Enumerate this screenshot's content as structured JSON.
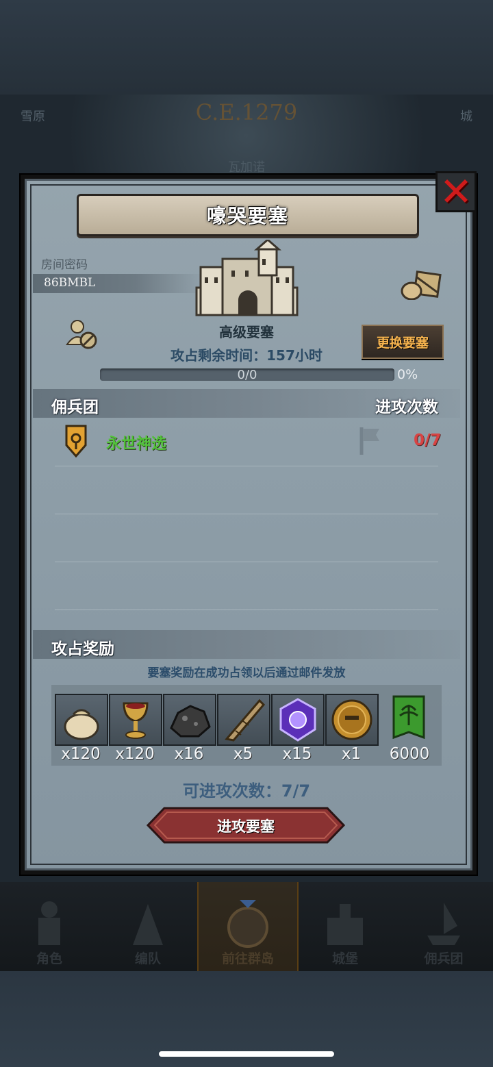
{
  "background": {
    "year": "C.E.1279",
    "tabs": [
      "雪原",
      "城"
    ],
    "center_label": "瓦加诺"
  },
  "dialog": {
    "title": "嚎哭要塞",
    "room_label": "房间密码",
    "room_code": "86BMBL",
    "fortress_type": "高级要塞",
    "change_button": "更换要塞",
    "timer_text": "攻占剩余时间：157小时",
    "progress": {
      "text": "0/0",
      "percent_text": "0%",
      "value": 0
    },
    "mercenary_header": "佣兵团",
    "attack_count_header": "进攻次数",
    "guild": {
      "name": "永世神选",
      "attacks": "0/7"
    },
    "reward_header": "攻占奖励",
    "reward_note": "要塞奖励在成功占领以后通过邮件发放",
    "rewards": [
      {
        "icon": "coin-bag-icon",
        "qty": "x120"
      },
      {
        "icon": "goblet-icon",
        "qty": "x120"
      },
      {
        "icon": "ore-icon",
        "qty": "x16"
      },
      {
        "icon": "horn-icon",
        "qty": "x5"
      },
      {
        "icon": "purple-gem-icon",
        "qty": "x15"
      },
      {
        "icon": "helmet-medal-icon",
        "qty": "x1"
      },
      {
        "icon": "guild-banner-icon",
        "qty": "6000"
      }
    ],
    "attacks_left": "可进攻次数：7/7",
    "attack_button": "进攻要塞"
  },
  "nav": [
    {
      "label": "角色",
      "icon": "knight-icon"
    },
    {
      "label": "编队",
      "icon": "formation-icon"
    },
    {
      "label": "前往群岛",
      "icon": "compass-icon",
      "active": true
    },
    {
      "label": "城堡",
      "icon": "castle-icon"
    },
    {
      "label": "佣兵团",
      "icon": "ship-icon"
    }
  ],
  "colors": {
    "panel": "#8e9ea8",
    "guild_name": "#52c23a",
    "attack_count": "#d84444",
    "change_button_text": "#f5b34e",
    "close": "#d01b1b"
  }
}
